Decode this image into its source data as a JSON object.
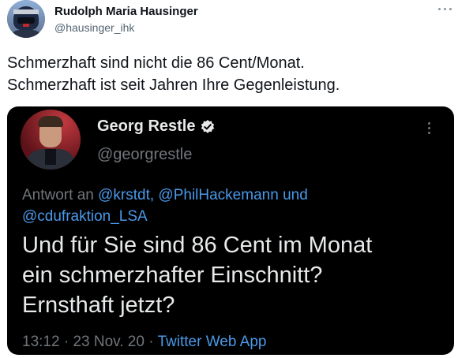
{
  "tweet": {
    "author_name": "Rudolph Maria Hausinger",
    "author_handle": "@hausinger_ihk",
    "text_lines": [
      "Schmerzhaft sind nicht die 86 Cent/Monat.",
      "Schmerzhaft ist seit Jahren Ihre Gegenleistung."
    ],
    "more_icon": "more-dots-icon"
  },
  "embedded": {
    "author_name": "Georg Restle",
    "verified_icon": "verified-badge-icon",
    "author_handle": "@georgrestle",
    "reply_prefix": "Antwort an",
    "reply_mentions": [
      "@krstdt,",
      "@PhilHackemann",
      "und",
      "@cdufraktion_LSA"
    ],
    "text_lines": [
      "Und für Sie sind 86 Cent im Monat",
      "ein schmerzhafter Einschnitt?",
      "Ernsthaft jetzt?"
    ],
    "time": "13:12",
    "date": "23 Nov. 20",
    "separator": "·",
    "source": "Twitter Web App"
  },
  "colors": {
    "link_blue": "#4a99e9",
    "embed_background": "#000000",
    "muted_gray": "#71767b"
  }
}
